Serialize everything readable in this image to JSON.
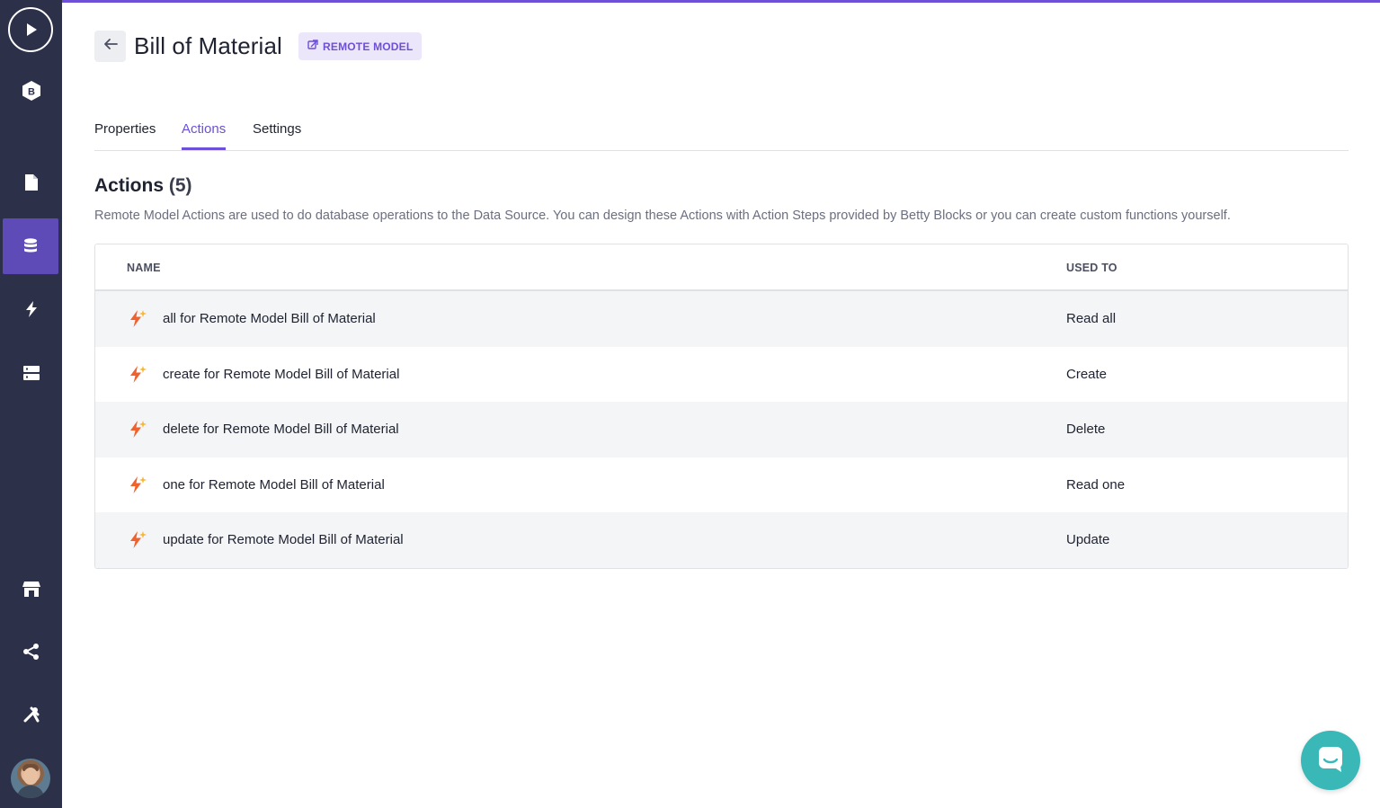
{
  "sidebar": {
    "items": [
      {
        "name": "play-icon",
        "active": false
      },
      {
        "name": "betty-logo-icon",
        "active": false,
        "letter": "B"
      },
      {
        "name": "page-icon",
        "active": false
      },
      {
        "name": "database-icon",
        "active": true
      },
      {
        "name": "lightning-icon",
        "active": false
      },
      {
        "name": "server-icon",
        "active": false
      },
      {
        "name": "store-icon",
        "active": false
      },
      {
        "name": "share-icon",
        "active": false
      },
      {
        "name": "tools-icon",
        "active": false
      }
    ]
  },
  "header": {
    "title": "Bill of Material",
    "badge": "REMOTE MODEL"
  },
  "tabs": [
    {
      "label": "Properties",
      "active": false
    },
    {
      "label": "Actions",
      "active": true
    },
    {
      "label": "Settings",
      "active": false
    }
  ],
  "section": {
    "title": "Actions",
    "count": "(5)",
    "description": "Remote Model Actions are used to do database operations to the Data Source. You can design these Actions with Action Steps provided by Betty Blocks or you can create custom functions yourself."
  },
  "table": {
    "columns": [
      "NAME",
      "USED TO"
    ],
    "rows": [
      {
        "name": "all for Remote Model Bill of Material",
        "used_to": "Read all"
      },
      {
        "name": "create for Remote Model Bill of Material",
        "used_to": "Create"
      },
      {
        "name": "delete for Remote Model Bill of Material",
        "used_to": "Delete"
      },
      {
        "name": "one for Remote Model Bill of Material",
        "used_to": "Read one"
      },
      {
        "name": "update for Remote Model Bill of Material",
        "used_to": "Update"
      }
    ]
  },
  "colors": {
    "accent": "#6d4fd8",
    "sidebar": "#2d3049",
    "sidebar_active": "#5e4bb8",
    "chat": "#3ab7b7",
    "action_icon": "#f0622d"
  }
}
